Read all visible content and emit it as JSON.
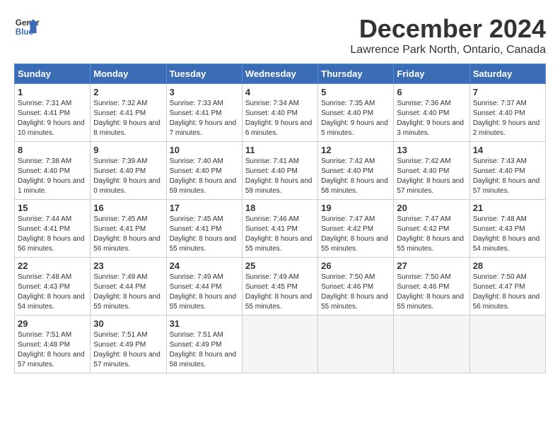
{
  "header": {
    "logo_line1": "General",
    "logo_line2": "Blue",
    "month": "December 2024",
    "location": "Lawrence Park North, Ontario, Canada"
  },
  "days_of_week": [
    "Sunday",
    "Monday",
    "Tuesday",
    "Wednesday",
    "Thursday",
    "Friday",
    "Saturday"
  ],
  "weeks": [
    [
      {
        "day": "1",
        "sunrise": "7:31 AM",
        "sunset": "4:41 PM",
        "daylight": "9 hours and 10 minutes."
      },
      {
        "day": "2",
        "sunrise": "7:32 AM",
        "sunset": "4:41 PM",
        "daylight": "9 hours and 8 minutes."
      },
      {
        "day": "3",
        "sunrise": "7:33 AM",
        "sunset": "4:41 PM",
        "daylight": "9 hours and 7 minutes."
      },
      {
        "day": "4",
        "sunrise": "7:34 AM",
        "sunset": "4:40 PM",
        "daylight": "9 hours and 6 minutes."
      },
      {
        "day": "5",
        "sunrise": "7:35 AM",
        "sunset": "4:40 PM",
        "daylight": "9 hours and 5 minutes."
      },
      {
        "day": "6",
        "sunrise": "7:36 AM",
        "sunset": "4:40 PM",
        "daylight": "9 hours and 3 minutes."
      },
      {
        "day": "7",
        "sunrise": "7:37 AM",
        "sunset": "4:40 PM",
        "daylight": "9 hours and 2 minutes."
      }
    ],
    [
      {
        "day": "8",
        "sunrise": "7:38 AM",
        "sunset": "4:40 PM",
        "daylight": "9 hours and 1 minute."
      },
      {
        "day": "9",
        "sunrise": "7:39 AM",
        "sunset": "4:40 PM",
        "daylight": "9 hours and 0 minutes."
      },
      {
        "day": "10",
        "sunrise": "7:40 AM",
        "sunset": "4:40 PM",
        "daylight": "8 hours and 59 minutes."
      },
      {
        "day": "11",
        "sunrise": "7:41 AM",
        "sunset": "4:40 PM",
        "daylight": "8 hours and 59 minutes."
      },
      {
        "day": "12",
        "sunrise": "7:42 AM",
        "sunset": "4:40 PM",
        "daylight": "8 hours and 58 minutes."
      },
      {
        "day": "13",
        "sunrise": "7:42 AM",
        "sunset": "4:40 PM",
        "daylight": "8 hours and 57 minutes."
      },
      {
        "day": "14",
        "sunrise": "7:43 AM",
        "sunset": "4:40 PM",
        "daylight": "8 hours and 57 minutes."
      }
    ],
    [
      {
        "day": "15",
        "sunrise": "7:44 AM",
        "sunset": "4:41 PM",
        "daylight": "8 hours and 56 minutes."
      },
      {
        "day": "16",
        "sunrise": "7:45 AM",
        "sunset": "4:41 PM",
        "daylight": "8 hours and 56 minutes."
      },
      {
        "day": "17",
        "sunrise": "7:45 AM",
        "sunset": "4:41 PM",
        "daylight": "8 hours and 55 minutes."
      },
      {
        "day": "18",
        "sunrise": "7:46 AM",
        "sunset": "4:41 PM",
        "daylight": "8 hours and 55 minutes."
      },
      {
        "day": "19",
        "sunrise": "7:47 AM",
        "sunset": "4:42 PM",
        "daylight": "8 hours and 55 minutes."
      },
      {
        "day": "20",
        "sunrise": "7:47 AM",
        "sunset": "4:42 PM",
        "daylight": "8 hours and 55 minutes."
      },
      {
        "day": "21",
        "sunrise": "7:48 AM",
        "sunset": "4:43 PM",
        "daylight": "8 hours and 54 minutes."
      }
    ],
    [
      {
        "day": "22",
        "sunrise": "7:48 AM",
        "sunset": "4:43 PM",
        "daylight": "8 hours and 54 minutes."
      },
      {
        "day": "23",
        "sunrise": "7:49 AM",
        "sunset": "4:44 PM",
        "daylight": "8 hours and 55 minutes."
      },
      {
        "day": "24",
        "sunrise": "7:49 AM",
        "sunset": "4:44 PM",
        "daylight": "8 hours and 55 minutes."
      },
      {
        "day": "25",
        "sunrise": "7:49 AM",
        "sunset": "4:45 PM",
        "daylight": "8 hours and 55 minutes."
      },
      {
        "day": "26",
        "sunrise": "7:50 AM",
        "sunset": "4:46 PM",
        "daylight": "8 hours and 55 minutes."
      },
      {
        "day": "27",
        "sunrise": "7:50 AM",
        "sunset": "4:46 PM",
        "daylight": "8 hours and 55 minutes."
      },
      {
        "day": "28",
        "sunrise": "7:50 AM",
        "sunset": "4:47 PM",
        "daylight": "8 hours and 56 minutes."
      }
    ],
    [
      {
        "day": "29",
        "sunrise": "7:51 AM",
        "sunset": "4:48 PM",
        "daylight": "8 hours and 57 minutes."
      },
      {
        "day": "30",
        "sunrise": "7:51 AM",
        "sunset": "4:49 PM",
        "daylight": "8 hours and 57 minutes."
      },
      {
        "day": "31",
        "sunrise": "7:51 AM",
        "sunset": "4:49 PM",
        "daylight": "8 hours and 58 minutes."
      },
      null,
      null,
      null,
      null
    ]
  ],
  "labels": {
    "sunrise": "Sunrise:",
    "sunset": "Sunset:",
    "daylight": "Daylight:"
  }
}
